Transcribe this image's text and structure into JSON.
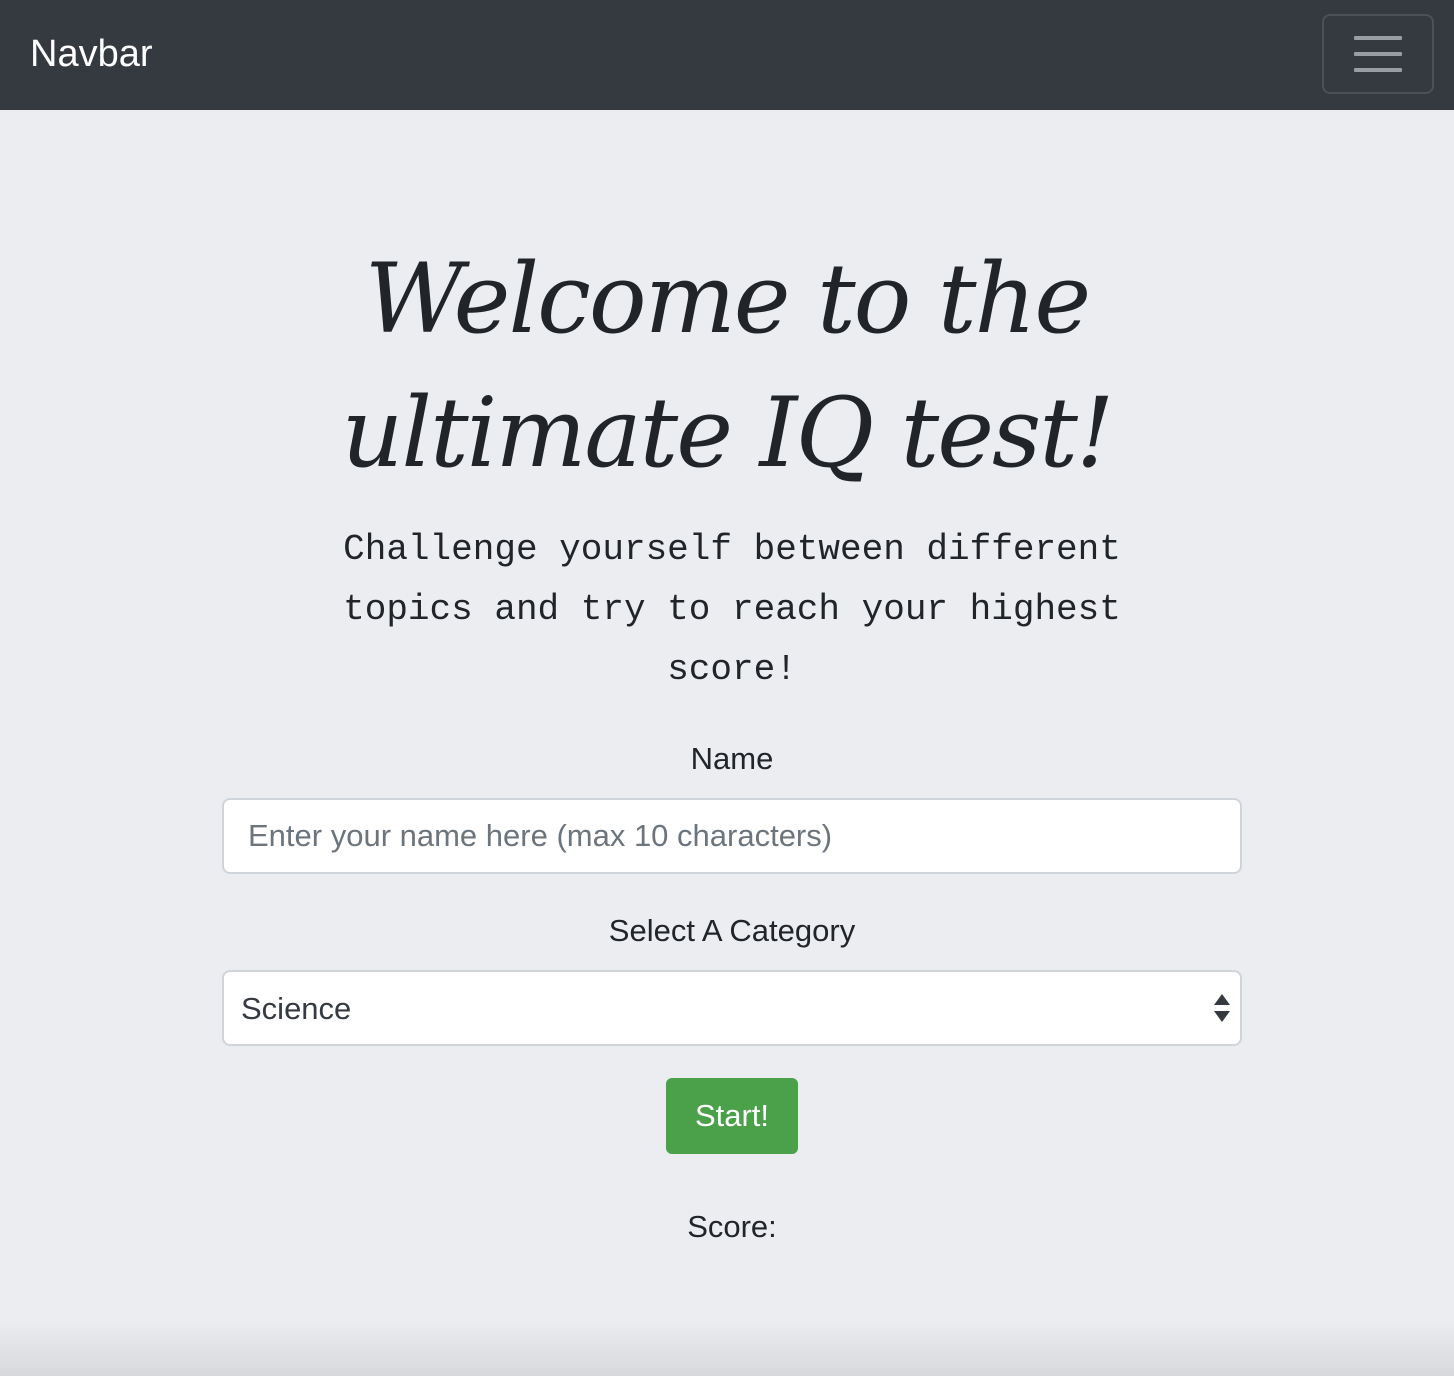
{
  "navbar": {
    "brand": "Navbar",
    "toggler_icon": "hamburger-menu-icon"
  },
  "hero": {
    "title_line1": "Welcome to the",
    "title_line2": "ultimate IQ test!",
    "subtitle_line1": "Challenge yourself between different",
    "subtitle_line2": "topics and try to reach your highest",
    "subtitle_line3": "score!"
  },
  "form": {
    "name_label": "Name",
    "name_placeholder": "Enter your name here (max 10 characters)",
    "name_value": "",
    "category_label": "Select A Category",
    "category_selected": "Science",
    "category_arrows_icon": "select-arrows-icon",
    "start_label": "Start!",
    "start_color": "#4aa14a"
  },
  "score": {
    "label": "Score:"
  },
  "colors": {
    "navbar_bg": "#343a40",
    "page_bg": "#ebedf1"
  }
}
